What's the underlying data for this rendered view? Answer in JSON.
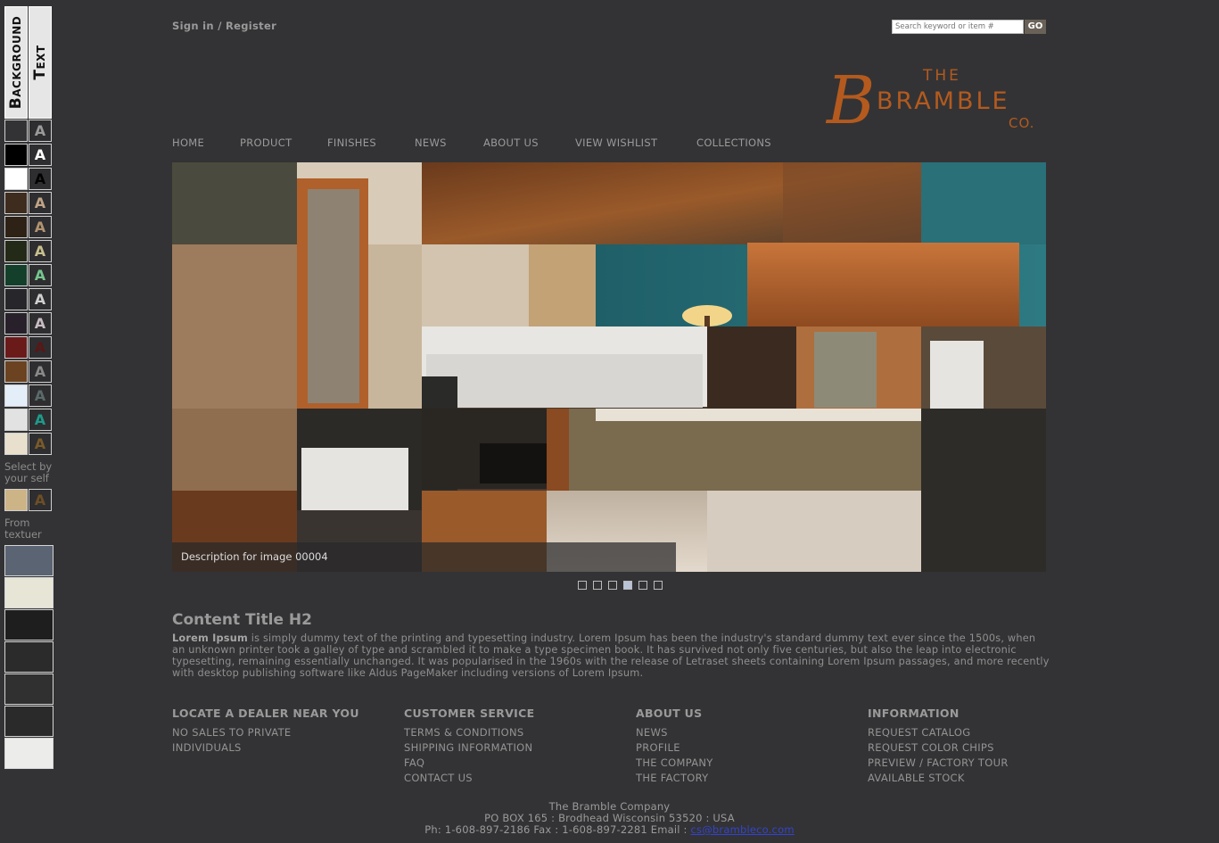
{
  "panel": {
    "background_label": "Background",
    "text_label": "Text",
    "swatches": [
      {
        "bg": "#333335",
        "fg": "#9a9a9a"
      },
      {
        "bg": "#000000",
        "fg": "#ffffff"
      },
      {
        "bg": "#ffffff",
        "fg": "#000000"
      },
      {
        "bg": "#3e2c1e",
        "fg": "#c0a488"
      },
      {
        "bg": "#2e2217",
        "fg": "#b29370"
      },
      {
        "bg": "#242a18",
        "fg": "#c7bf8d"
      },
      {
        "bg": "#14402b",
        "fg": "#76c58f"
      },
      {
        "bg": "#27262a",
        "fg": "#cfcfcf"
      },
      {
        "bg": "#28202a",
        "fg": "#c8bcc2"
      },
      {
        "bg": "#6b1a1a",
        "fg": "#5a1616"
      },
      {
        "bg": "#6b4320",
        "fg": "#8a8a8a"
      },
      {
        "bg": "#e4eef8",
        "fg": "#5b6a6a"
      },
      {
        "bg": "#e2e2e2",
        "fg": "#1e9a8a"
      },
      {
        "bg": "#e8e0cc",
        "fg": "#7a5a2a"
      }
    ],
    "select_label": "Select by your self",
    "custom": {
      "bg": "#cdb486",
      "fg": "#6e4e26"
    },
    "from_label": "From textuer",
    "textures": [
      "#5a6472",
      "#e7e5d6",
      "#1e1e1e",
      "#2b2b2b",
      "#303030",
      "#2a2a2a",
      "#ececea"
    ]
  },
  "header": {
    "signin": "Sign in",
    "separator": " / ",
    "register": "Register",
    "search_placeholder": "Search keyword or item #",
    "go": "GO"
  },
  "logo": {
    "the": "THE",
    "bramble": "BRAMBLE",
    "co": "CO.",
    "accent": "#b45a1e"
  },
  "nav": [
    "HOME",
    "PRODUCT",
    "FINISHES",
    "NEWS",
    "ABOUT US",
    "VIEW WISHLIST",
    "COLLECTIONS"
  ],
  "slideshow": {
    "caption": "Description for image 00004",
    "dots": 6,
    "active": 3
  },
  "content": {
    "title": "Content Title H2",
    "lead": "Lorem Ipsum",
    "body": " is simply dummy text of the printing and typesetting industry. Lorem Ipsum has been the industry's standard dummy text ever since the 1500s, when an unknown printer took a galley of type and scrambled it to make a type specimen book. It has survived not only five centuries, but also the leap into electronic typesetting, remaining essentially unchanged. It was popularised in the 1960s with the release of Letraset sheets containing Lorem Ipsum passages, and more recently with desktop publishing software like Aldus PageMaker including versions of Lorem Ipsum."
  },
  "footer": {
    "columns": [
      {
        "title": "LOCATE A DEALER NEAR YOU",
        "items": [
          "NO SALES TO PRIVATE",
          "INDIVIDUALS"
        ]
      },
      {
        "title": "CUSTOMER SERVICE",
        "items": [
          "TERMS & CONDITIONS",
          "SHIPPING INFORMATION",
          "FAQ",
          "CONTACT US"
        ]
      },
      {
        "title": "ABOUT US",
        "items": [
          "NEWS",
          "PROFILE",
          "THE COMPANY",
          "THE FACTORY"
        ]
      },
      {
        "title": "INFORMATION",
        "items": [
          "REQUEST CATALOG",
          "REQUEST COLOR CHIPS",
          "PREVIEW / FACTORY TOUR",
          "AVAILABLE STOCK"
        ]
      }
    ],
    "company": "The Bramble Company",
    "address": "PO BOX 165 : Brodhead Wisconsin 53520 : USA",
    "phone": "Ph: 1-608-897-2186 Fax : 1-608-897-2281 Email : ",
    "email": "cs@brambleco.com"
  }
}
